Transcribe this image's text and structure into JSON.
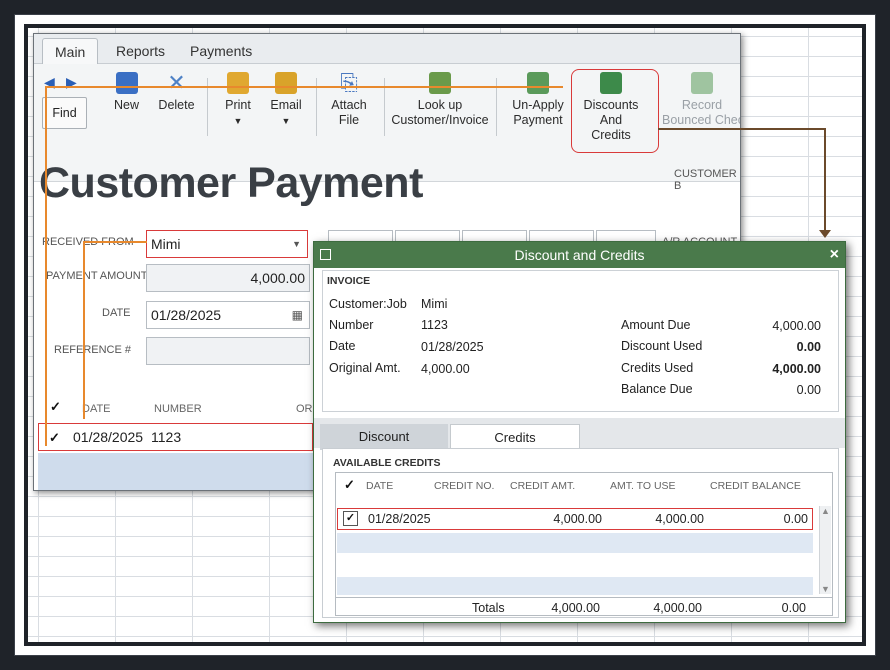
{
  "customer_payment": {
    "tabs": [
      "Main",
      "Reports",
      "Payments"
    ],
    "toolbar": {
      "find": "Find",
      "new": "New",
      "delete": "Delete",
      "print": "Print",
      "email": "Email",
      "attach_line1": "Attach",
      "attach_line2": "File",
      "lookup_line1": "Look up",
      "lookup_line2": "Customer/Invoice",
      "unapply_line1": "Un-Apply",
      "unapply_line2": "Payment",
      "discounts_line1": "Discounts And",
      "discounts_line2": "Credits",
      "record_line1": "Record",
      "record_line2": "Bounced Chec"
    },
    "title": "Customer Payment",
    "customer_balance_label": "CUSTOMER B",
    "received_from_label": "RECEIVED FROM",
    "received_from_value": "Mimi",
    "payment_amount_label": "PAYMENT AMOUNT",
    "payment_amount_value": "4,000.00",
    "date_label": "DATE",
    "date_value": "01/28/2025",
    "reference_label": "REFERENCE #",
    "ar_account_label": "A/R ACCOUNT",
    "grid_headers": [
      "DATE",
      "NUMBER",
      "ORIG"
    ],
    "grid_row": {
      "date": "01/28/2025",
      "number": "1123"
    }
  },
  "discount_credits": {
    "title": "Discount and Credits",
    "invoice_section_title": "INVOICE",
    "customer_job_label": "Customer:Job",
    "customer_job_value": "Mimi",
    "number_label": "Number",
    "number_value": "1123",
    "date_label": "Date",
    "date_value": "01/28/2025",
    "original_amt_label": "Original Amt.",
    "original_amt_value": "4,000.00",
    "amount_due_label": "Amount Due",
    "amount_due_value": "4,000.00",
    "discount_used_label": "Discount Used",
    "discount_used_value": "0.00",
    "credits_used_label": "Credits Used",
    "credits_used_value": "4,000.00",
    "balance_due_label": "Balance Due",
    "balance_due_value": "0.00",
    "tab_discount": "Discount",
    "tab_credits": "Credits",
    "available_credits_title": "AVAILABLE CREDITS",
    "columns": [
      "DATE",
      "CREDIT NO.",
      "CREDIT AMT.",
      "AMT. TO USE",
      "CREDIT BALANCE"
    ],
    "row": {
      "date": "01/28/2025",
      "credit_no": "",
      "credit_amt": "4,000.00",
      "amt_to_use": "4,000.00",
      "credit_balance": "0.00"
    },
    "totals_label": "Totals",
    "totals_credit_amt": "4,000.00",
    "totals_amt_to_use": "4,000.00",
    "totals_credit_balance": "0.00"
  },
  "colors": {
    "highlight_red": "#d93a3a",
    "arrow_orange": "#e8892d",
    "arrow_brown": "#6b4a2b",
    "dialog_title_green": "#4a7a4b",
    "grid_blue": "#cfdcec"
  }
}
